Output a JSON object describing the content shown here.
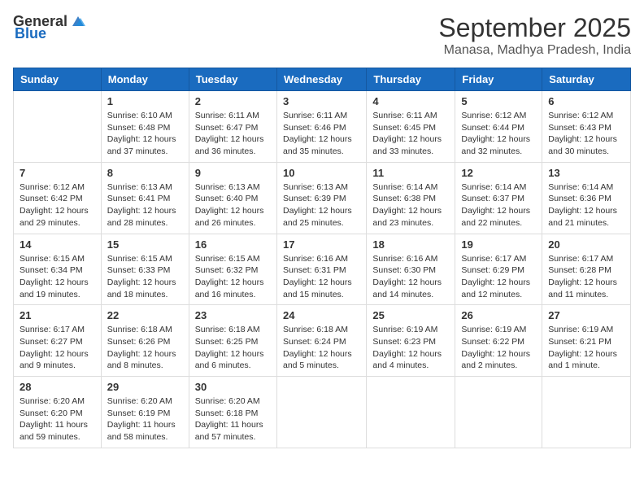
{
  "header": {
    "logo_general": "General",
    "logo_blue": "Blue",
    "month": "September 2025",
    "location": "Manasa, Madhya Pradesh, India"
  },
  "days_of_week": [
    "Sunday",
    "Monday",
    "Tuesday",
    "Wednesday",
    "Thursday",
    "Friday",
    "Saturday"
  ],
  "weeks": [
    [
      {
        "day": "",
        "info": ""
      },
      {
        "day": "1",
        "info": "Sunrise: 6:10 AM\nSunset: 6:48 PM\nDaylight: 12 hours\nand 37 minutes."
      },
      {
        "day": "2",
        "info": "Sunrise: 6:11 AM\nSunset: 6:47 PM\nDaylight: 12 hours\nand 36 minutes."
      },
      {
        "day": "3",
        "info": "Sunrise: 6:11 AM\nSunset: 6:46 PM\nDaylight: 12 hours\nand 35 minutes."
      },
      {
        "day": "4",
        "info": "Sunrise: 6:11 AM\nSunset: 6:45 PM\nDaylight: 12 hours\nand 33 minutes."
      },
      {
        "day": "5",
        "info": "Sunrise: 6:12 AM\nSunset: 6:44 PM\nDaylight: 12 hours\nand 32 minutes."
      },
      {
        "day": "6",
        "info": "Sunrise: 6:12 AM\nSunset: 6:43 PM\nDaylight: 12 hours\nand 30 minutes."
      }
    ],
    [
      {
        "day": "7",
        "info": "Sunrise: 6:12 AM\nSunset: 6:42 PM\nDaylight: 12 hours\nand 29 minutes."
      },
      {
        "day": "8",
        "info": "Sunrise: 6:13 AM\nSunset: 6:41 PM\nDaylight: 12 hours\nand 28 minutes."
      },
      {
        "day": "9",
        "info": "Sunrise: 6:13 AM\nSunset: 6:40 PM\nDaylight: 12 hours\nand 26 minutes."
      },
      {
        "day": "10",
        "info": "Sunrise: 6:13 AM\nSunset: 6:39 PM\nDaylight: 12 hours\nand 25 minutes."
      },
      {
        "day": "11",
        "info": "Sunrise: 6:14 AM\nSunset: 6:38 PM\nDaylight: 12 hours\nand 23 minutes."
      },
      {
        "day": "12",
        "info": "Sunrise: 6:14 AM\nSunset: 6:37 PM\nDaylight: 12 hours\nand 22 minutes."
      },
      {
        "day": "13",
        "info": "Sunrise: 6:14 AM\nSunset: 6:36 PM\nDaylight: 12 hours\nand 21 minutes."
      }
    ],
    [
      {
        "day": "14",
        "info": "Sunrise: 6:15 AM\nSunset: 6:34 PM\nDaylight: 12 hours\nand 19 minutes."
      },
      {
        "day": "15",
        "info": "Sunrise: 6:15 AM\nSunset: 6:33 PM\nDaylight: 12 hours\nand 18 minutes."
      },
      {
        "day": "16",
        "info": "Sunrise: 6:15 AM\nSunset: 6:32 PM\nDaylight: 12 hours\nand 16 minutes."
      },
      {
        "day": "17",
        "info": "Sunrise: 6:16 AM\nSunset: 6:31 PM\nDaylight: 12 hours\nand 15 minutes."
      },
      {
        "day": "18",
        "info": "Sunrise: 6:16 AM\nSunset: 6:30 PM\nDaylight: 12 hours\nand 14 minutes."
      },
      {
        "day": "19",
        "info": "Sunrise: 6:17 AM\nSunset: 6:29 PM\nDaylight: 12 hours\nand 12 minutes."
      },
      {
        "day": "20",
        "info": "Sunrise: 6:17 AM\nSunset: 6:28 PM\nDaylight: 12 hours\nand 11 minutes."
      }
    ],
    [
      {
        "day": "21",
        "info": "Sunrise: 6:17 AM\nSunset: 6:27 PM\nDaylight: 12 hours\nand 9 minutes."
      },
      {
        "day": "22",
        "info": "Sunrise: 6:18 AM\nSunset: 6:26 PM\nDaylight: 12 hours\nand 8 minutes."
      },
      {
        "day": "23",
        "info": "Sunrise: 6:18 AM\nSunset: 6:25 PM\nDaylight: 12 hours\nand 6 minutes."
      },
      {
        "day": "24",
        "info": "Sunrise: 6:18 AM\nSunset: 6:24 PM\nDaylight: 12 hours\nand 5 minutes."
      },
      {
        "day": "25",
        "info": "Sunrise: 6:19 AM\nSunset: 6:23 PM\nDaylight: 12 hours\nand 4 minutes."
      },
      {
        "day": "26",
        "info": "Sunrise: 6:19 AM\nSunset: 6:22 PM\nDaylight: 12 hours\nand 2 minutes."
      },
      {
        "day": "27",
        "info": "Sunrise: 6:19 AM\nSunset: 6:21 PM\nDaylight: 12 hours\nand 1 minute."
      }
    ],
    [
      {
        "day": "28",
        "info": "Sunrise: 6:20 AM\nSunset: 6:20 PM\nDaylight: 11 hours\nand 59 minutes."
      },
      {
        "day": "29",
        "info": "Sunrise: 6:20 AM\nSunset: 6:19 PM\nDaylight: 11 hours\nand 58 minutes."
      },
      {
        "day": "30",
        "info": "Sunrise: 6:20 AM\nSunset: 6:18 PM\nDaylight: 11 hours\nand 57 minutes."
      },
      {
        "day": "",
        "info": ""
      },
      {
        "day": "",
        "info": ""
      },
      {
        "day": "",
        "info": ""
      },
      {
        "day": "",
        "info": ""
      }
    ]
  ]
}
